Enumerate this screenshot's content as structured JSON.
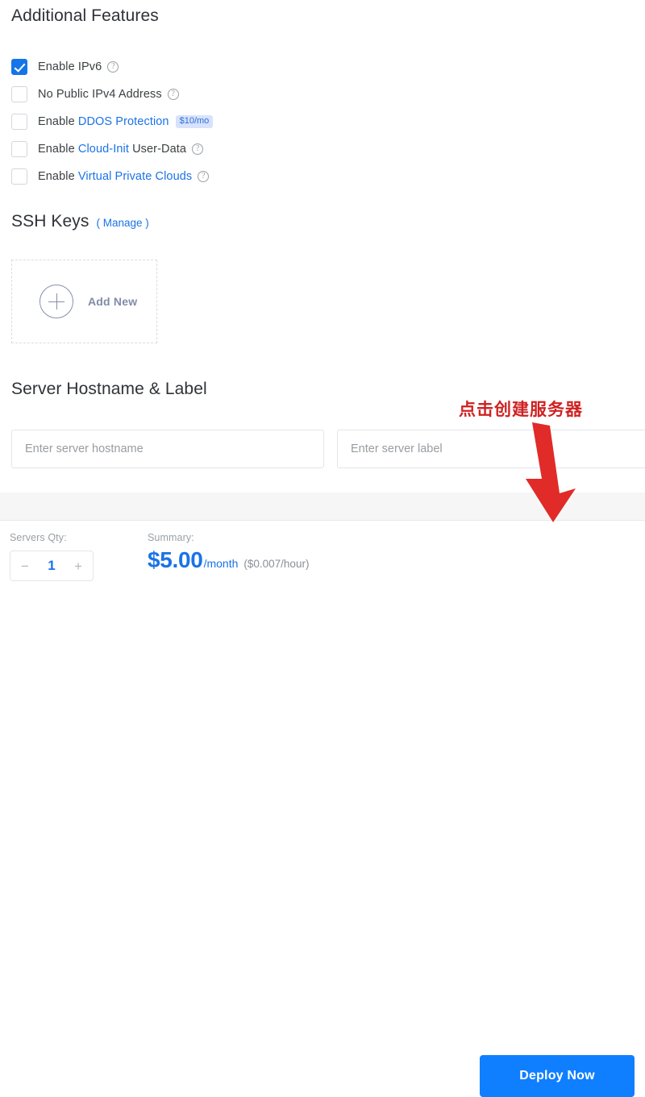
{
  "additional_features": {
    "title": "Additional Features",
    "items": [
      {
        "label_before": "Enable IPv6",
        "link": "",
        "label_after": "",
        "checked": true,
        "help": "?",
        "badge": ""
      },
      {
        "label_before": "No Public IPv4 Address",
        "link": "",
        "label_after": "",
        "checked": false,
        "help": "?",
        "badge": ""
      },
      {
        "label_before": "Enable ",
        "link": "DDOS Protection",
        "label_after": "",
        "checked": false,
        "help": "",
        "badge": "$10/mo"
      },
      {
        "label_before": "Enable ",
        "link": "Cloud-Init",
        "label_after": " User-Data",
        "checked": false,
        "help": "?",
        "badge": ""
      },
      {
        "label_before": "Enable ",
        "link": "Virtual Private Clouds",
        "label_after": "",
        "checked": false,
        "help": "?",
        "badge": ""
      }
    ]
  },
  "ssh_keys": {
    "title": "SSH Keys",
    "manage_link": "( Manage )",
    "add_new_label": "Add New",
    "plus_icon": "plus-icon"
  },
  "hostname_section": {
    "title": "Server Hostname & Label",
    "hostname_placeholder": "Enter server hostname",
    "hostname_value": "",
    "label_placeholder": "Enter server label",
    "label_value": ""
  },
  "footer": {
    "qty_caption": "Servers Qty:",
    "qty_decrement": "−",
    "qty_value": "1",
    "qty_increment": "+",
    "summary_caption": "Summary:",
    "summary_amount": "$5.00",
    "summary_period": "/month",
    "summary_hourly": "($0.007/hour)",
    "deploy_label": "Deploy Now"
  },
  "annotation": {
    "text": "点击创建服务器",
    "arrow": "down-arrow-icon",
    "color": "#cf2222"
  },
  "colors": {
    "accent_blue": "#1a73e8",
    "button_blue": "#0f7fff",
    "badge_bg": "#d7e2fb",
    "annotation_red": "#cf2222"
  }
}
